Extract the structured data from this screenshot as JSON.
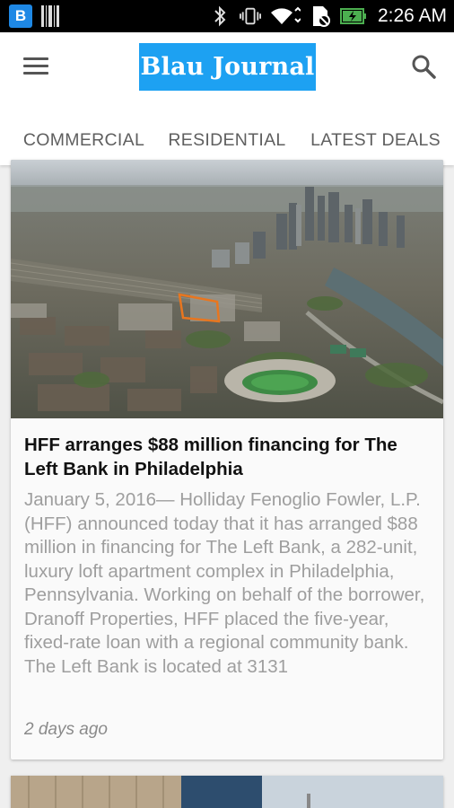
{
  "status_bar": {
    "app_badge": "B",
    "time": "2:26 AM"
  },
  "header": {
    "logo_text": "Blau Journal"
  },
  "tabs": [
    {
      "label": "COMMERCIAL"
    },
    {
      "label": "RESIDENTIAL",
      "selected": true
    },
    {
      "label": "LATEST DEALS"
    }
  ],
  "feed": {
    "articles": [
      {
        "title": "HFF arranges $88 million financing for The Left Bank in Philadelphia",
        "excerpt": "January 5, 2016— Holliday Fenoglio Fowler, L.P. (HFF) announced today that it has arranged $88 million in financing for The Left Bank, a 282-unit, luxury loft apartment complex in Philadelphia, Pennsylvania. Working on behalf of the borrower, Dranoff Properties, HFF placed the five-year, fixed-rate loan with a regional community bank. The Left Bank is located at 3131",
        "time_ago": "2 days ago"
      }
    ]
  },
  "colors": {
    "logo_bg": "#1da1f2",
    "status_bar_bg": "#000000",
    "tab_indicator": "#9e9e9e",
    "excerpt_text": "#9e9e9e"
  },
  "icons": {
    "menu": "hamburger-menu-icon",
    "search": "search-icon",
    "bluetooth": "bluetooth-icon",
    "vibrate": "vibrate-icon",
    "wifi": "wifi-icon",
    "no_sim": "no-sim-icon",
    "battery": "battery-charging-icon"
  }
}
